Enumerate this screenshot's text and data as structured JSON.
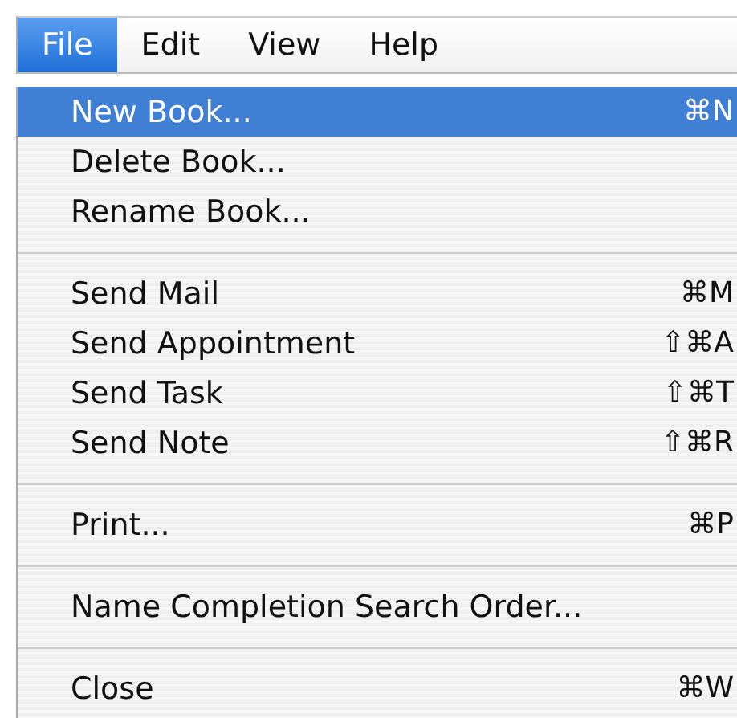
{
  "menubar": [
    {
      "label": "File",
      "selected": true
    },
    {
      "label": "Edit",
      "selected": false
    },
    {
      "label": "View",
      "selected": false
    },
    {
      "label": "Help",
      "selected": false
    }
  ],
  "menu": [
    {
      "kind": "item",
      "label": "New Book...",
      "shortcut": "⌘N",
      "selected": true
    },
    {
      "kind": "item",
      "label": "Delete Book...",
      "selected": false
    },
    {
      "kind": "item",
      "label": "Rename Book...",
      "selected": false
    },
    {
      "kind": "separator"
    },
    {
      "kind": "item",
      "label": "Send Mail",
      "shortcut": "⌘M",
      "selected": false
    },
    {
      "kind": "item",
      "label": "Send Appointment",
      "shortcut": "⇧⌘A",
      "selected": false
    },
    {
      "kind": "item",
      "label": "Send Task",
      "shortcut": "⇧⌘T",
      "selected": false
    },
    {
      "kind": "item",
      "label": "Send Note",
      "shortcut": "⇧⌘R",
      "selected": false
    },
    {
      "kind": "separator"
    },
    {
      "kind": "item",
      "label": "Print...",
      "shortcut": "⌘P",
      "selected": false
    },
    {
      "kind": "separator"
    },
    {
      "kind": "item",
      "label": "Name Completion Search Order...",
      "selected": false
    },
    {
      "kind": "separator"
    },
    {
      "kind": "item",
      "label": "Close",
      "shortcut": "⌘W",
      "selected": false
    }
  ]
}
